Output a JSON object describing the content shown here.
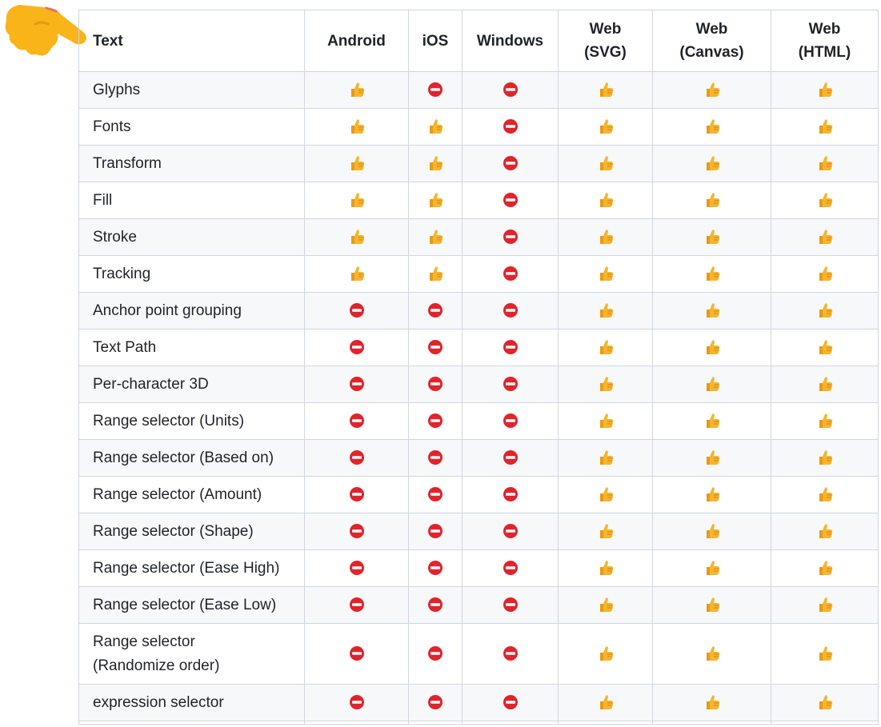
{
  "table": {
    "headers": [
      "Text",
      "Android",
      "iOS",
      "Windows",
      "Web\n(SVG)",
      "Web\n(Canvas)",
      "Web\n(HTML)"
    ],
    "rows": [
      {
        "name": "Glyphs",
        "support": [
          "yes",
          "no",
          "no",
          "yes",
          "yes",
          "yes"
        ]
      },
      {
        "name": "Fonts",
        "support": [
          "yes",
          "yes",
          "no",
          "yes",
          "yes",
          "yes"
        ]
      },
      {
        "name": "Transform",
        "support": [
          "yes",
          "yes",
          "no",
          "yes",
          "yes",
          "yes"
        ]
      },
      {
        "name": "Fill",
        "support": [
          "yes",
          "yes",
          "no",
          "yes",
          "yes",
          "yes"
        ]
      },
      {
        "name": "Stroke",
        "support": [
          "yes",
          "yes",
          "no",
          "yes",
          "yes",
          "yes"
        ]
      },
      {
        "name": "Tracking",
        "support": [
          "yes",
          "yes",
          "no",
          "yes",
          "yes",
          "yes"
        ]
      },
      {
        "name": "Anchor point grouping",
        "support": [
          "no",
          "no",
          "no",
          "yes",
          "yes",
          "yes"
        ]
      },
      {
        "name": "Text Path",
        "support": [
          "no",
          "no",
          "no",
          "yes",
          "yes",
          "yes"
        ]
      },
      {
        "name": "Per-character 3D",
        "support": [
          "no",
          "no",
          "no",
          "yes",
          "yes",
          "yes"
        ]
      },
      {
        "name": "Range selector (Units)",
        "support": [
          "no",
          "no",
          "no",
          "yes",
          "yes",
          "yes"
        ]
      },
      {
        "name": "Range selector (Based on)",
        "support": [
          "no",
          "no",
          "no",
          "yes",
          "yes",
          "yes"
        ]
      },
      {
        "name": "Range selector (Amount)",
        "support": [
          "no",
          "no",
          "no",
          "yes",
          "yes",
          "yes"
        ]
      },
      {
        "name": "Range selector (Shape)",
        "support": [
          "no",
          "no",
          "no",
          "yes",
          "yes",
          "yes"
        ]
      },
      {
        "name": "Range selector (Ease High)",
        "support": [
          "no",
          "no",
          "no",
          "yes",
          "yes",
          "yes"
        ]
      },
      {
        "name": "Range selector (Ease Low)",
        "support": [
          "no",
          "no",
          "no",
          "yes",
          "yes",
          "yes"
        ]
      },
      {
        "name": "Range selector\n(Randomize order)",
        "support": [
          "no",
          "no",
          "no",
          "yes",
          "yes",
          "yes"
        ]
      },
      {
        "name": "expression selector",
        "support": [
          "no",
          "no",
          "no",
          "yes",
          "yes",
          "yes"
        ]
      }
    ]
  },
  "icons": {
    "yes": "thumbs-up-icon",
    "no": "no-entry-icon",
    "pointer": "pointing-hand-icon"
  },
  "colors": {
    "thumb": "#f5b52e",
    "no_entry": "#e0242c",
    "pointer": "#f8b419",
    "border": "#d0d7de",
    "stripe": "#f6f8fa"
  }
}
